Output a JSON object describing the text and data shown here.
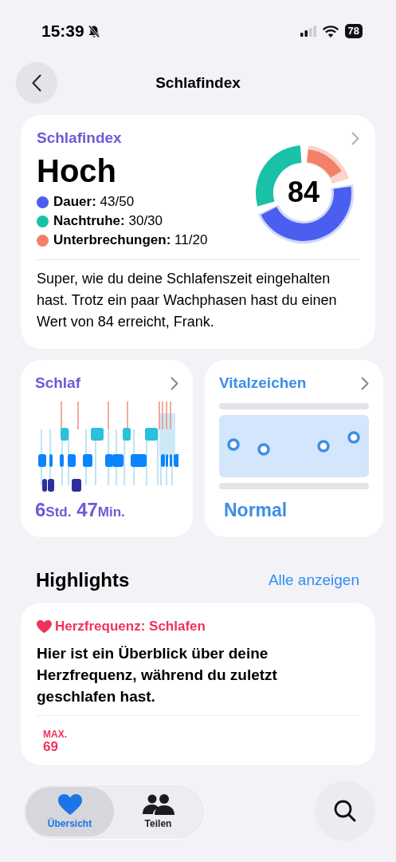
{
  "status_bar": {
    "time": "15:39",
    "battery": "78"
  },
  "nav": {
    "title": "Schlafindex"
  },
  "score_card": {
    "title": "Schlafindex",
    "rating": "Hoch",
    "score": "84",
    "components": [
      {
        "label": "Dauer:",
        "value": "43/50",
        "color": "#4a5ef0"
      },
      {
        "label": "Nachtruhe:",
        "value": "30/30",
        "color": "#19c2a6"
      },
      {
        "label": "Unterbrechungen:",
        "value": "11/20",
        "color": "#f4806a"
      }
    ],
    "summary": "Super, wie du deine Schlafenszeit eingehalten hast. Trotz ein paar Wachphasen hast du einen Wert von 84 erreicht, Frank."
  },
  "sleep_card": {
    "title": "Schlaf",
    "hours": "6",
    "hours_unit": "Std.",
    "minutes": "47",
    "minutes_unit": "Min."
  },
  "vitals_card": {
    "title": "Vitalzeichen",
    "status": "Normal"
  },
  "highlights": {
    "title": "Highlights",
    "link": "Alle anzeigen",
    "cards": [
      {
        "title": "Herzfrequenz: Schlafen",
        "text": "Hier ist ein Überblick über deine Herzfrequenz, während du zuletzt geschlafen hast.",
        "stat_label": "MAX.",
        "stat_value": "69"
      }
    ]
  },
  "tab_bar": {
    "tabs": [
      {
        "label": "Übersicht",
        "kind": "heart",
        "selected": true
      },
      {
        "label": "Teilen",
        "kind": "people",
        "selected": false
      }
    ]
  }
}
